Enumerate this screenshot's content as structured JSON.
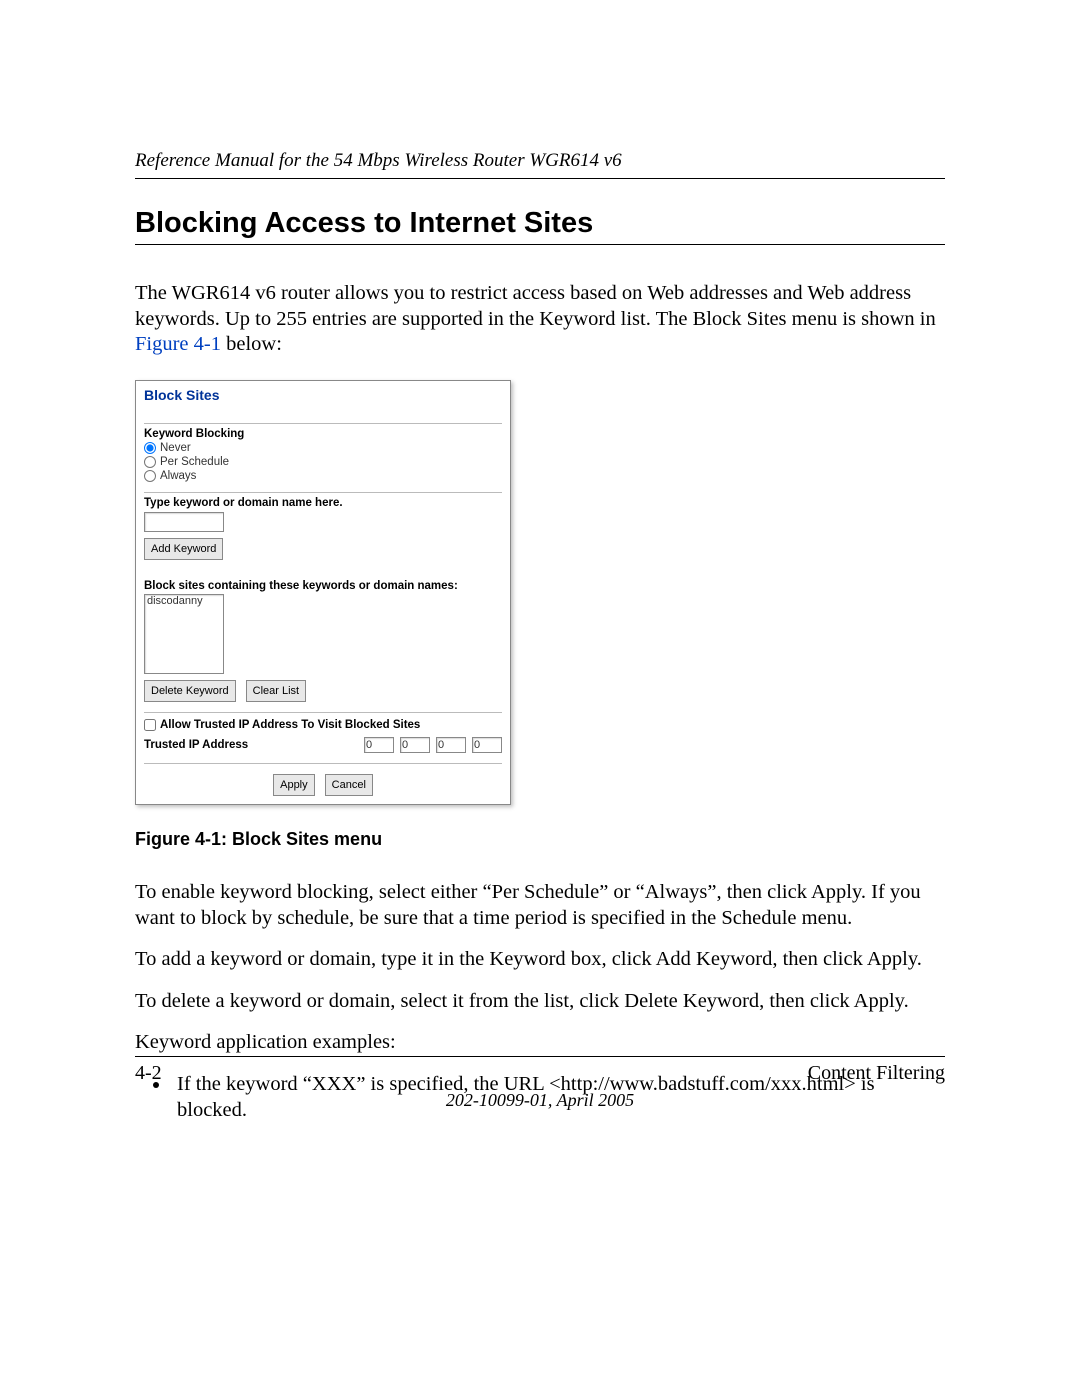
{
  "header": {
    "running": "Reference Manual for the 54 Mbps Wireless Router WGR614 v6"
  },
  "section": {
    "title": "Blocking Access to Internet Sites"
  },
  "intro": {
    "p1a": "The WGR614 v6 router allows you to restrict access based on Web addresses and Web address keywords. Up to 255 entries are supported in the Keyword list. The Block Sites menu is shown in ",
    "link": "Figure 4-1",
    "p1b": " below:"
  },
  "figure": {
    "caption": "Figure 4-1:  Block Sites menu",
    "panel_title": "Block Sites",
    "keyword_blocking_label": "Keyword Blocking",
    "radios": {
      "never": "Never",
      "per_schedule": "Per Schedule",
      "always": "Always"
    },
    "type_keyword_label": "Type keyword or domain name here.",
    "add_keyword_btn": "Add Keyword",
    "block_list_label": "Block sites containing these keywords or domain names:",
    "list_item": "discodanny",
    "delete_keyword_btn": "Delete Keyword",
    "clear_list_btn": "Clear List",
    "allow_trusted_label": "Allow Trusted IP Address To Visit Blocked Sites",
    "trusted_ip_label": "Trusted IP Address",
    "ip": [
      "0",
      "0",
      "0",
      "0"
    ],
    "apply_btn": "Apply",
    "cancel_btn": "Cancel"
  },
  "after": {
    "p1": "To enable keyword blocking, select either “Per Schedule” or “Always”, then click Apply. If you want to block by schedule, be sure that a time period is specified in the Schedule menu.",
    "p2": "To add a keyword or domain, type it in the Keyword box, click Add Keyword, then click Apply.",
    "p3": "To delete a keyword or domain, select it from the list, click Delete Keyword, then click Apply.",
    "p4": "Keyword application examples:",
    "bullet1": "If the keyword “XXX” is specified, the URL <http://www.badstuff.com/xxx.html> is blocked."
  },
  "footer": {
    "page_num": "4-2",
    "chapter": "Content Filtering",
    "docnum": "202-10099-01, April 2005"
  }
}
